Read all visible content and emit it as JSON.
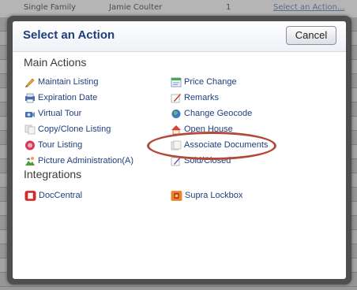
{
  "background": {
    "top_row": {
      "type": "Single Family",
      "agent": "Jamie Coulter",
      "count": "1",
      "action_link": "Select an Action..."
    }
  },
  "dialog": {
    "title": "Select an Action",
    "cancel_label": "Cancel",
    "main_heading": "Main Actions",
    "integrations_heading": "Integrations",
    "main_left": [
      {
        "label": "Maintain Listing",
        "icon": "pencil-icon"
      },
      {
        "label": "Expiration Date",
        "icon": "printer-icon"
      },
      {
        "label": "Virtual Tour",
        "icon": "camera-icon"
      },
      {
        "label": "Copy/Clone Listing",
        "icon": "copy-icon"
      },
      {
        "label": "Tour Listing",
        "icon": "tour-icon"
      },
      {
        "label": "Picture Administration(A)",
        "icon": "picture-icon"
      }
    ],
    "main_right": [
      {
        "label": "Price Change",
        "icon": "price-icon"
      },
      {
        "label": "Remarks",
        "icon": "remarks-icon"
      },
      {
        "label": "Change Geocode",
        "icon": "globe-icon"
      },
      {
        "label": "Open House",
        "icon": "house-icon"
      },
      {
        "label": "Associate Documents",
        "icon": "documents-icon"
      },
      {
        "label": "Sold/Closed",
        "icon": "sold-icon"
      }
    ],
    "integrations": [
      {
        "label": "DocCentral",
        "icon": "doccentral-icon"
      },
      {
        "label": "Supra Lockbox",
        "icon": "lockbox-icon"
      }
    ]
  },
  "colors": {
    "title": "#1b3f7a",
    "link": "#1f3e7e",
    "highlight": "#b24a3a"
  }
}
